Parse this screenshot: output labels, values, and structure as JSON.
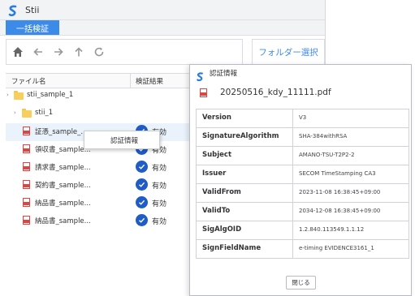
{
  "app": {
    "title": "Stii"
  },
  "menu": {
    "tab_label": "一括検証"
  },
  "toolbar": {
    "folder_select_label": "フォルダー選択"
  },
  "table": {
    "headers": [
      "ファイル名",
      "検証結果"
    ],
    "rows": [
      {
        "label": "stii_sample_1",
        "type": "folder",
        "status": ""
      },
      {
        "label": "stii_1",
        "type": "folder",
        "status": ""
      },
      {
        "label": "証憑_sample_...",
        "type": "pdf",
        "status": "有効"
      },
      {
        "label": "領収書_sample...",
        "type": "pdf",
        "status": "有効"
      },
      {
        "label": "請求書_sample...",
        "type": "pdf",
        "status": "有効"
      },
      {
        "label": "契約書_sample...",
        "type": "pdf",
        "status": "有効"
      },
      {
        "label": "納品書_sample...",
        "type": "pdf",
        "status": "有効"
      },
      {
        "label": "納品書_sample...",
        "type": "pdf",
        "status": "有効"
      }
    ]
  },
  "context_menu": {
    "item_label": "認証情報"
  },
  "dialog": {
    "title": "認証情報",
    "file_name": "20250516_kdy_11111.pdf",
    "pdf_badge": "PDF",
    "properties": [
      {
        "key": "Version",
        "value": "V3"
      },
      {
        "key": "SignatureAlgorithm",
        "value": "SHA-384withRSA"
      },
      {
        "key": "Subject",
        "value": "AMANO-TSU-T2P2-2"
      },
      {
        "key": "Issuer",
        "value": "SECOM TimeStamping CA3"
      },
      {
        "key": "ValidFrom",
        "value": "2023-11-08 16:38:45+09:00"
      },
      {
        "key": "ValidTo",
        "value": "2034-12-08 16:38:45+09:00"
      },
      {
        "key": "SigAlgOID",
        "value": "1.2.840.113549.1.1.12"
      },
      {
        "key": "SignFieldName",
        "value": "e-timing EVIDENCE3161_1"
      }
    ],
    "close_label": "閉じる"
  },
  "colors": {
    "accent": "#3d8be8",
    "status_ok": "#1f5cc7",
    "pdf": "#dd4444",
    "folder": "#f6cf5f"
  }
}
